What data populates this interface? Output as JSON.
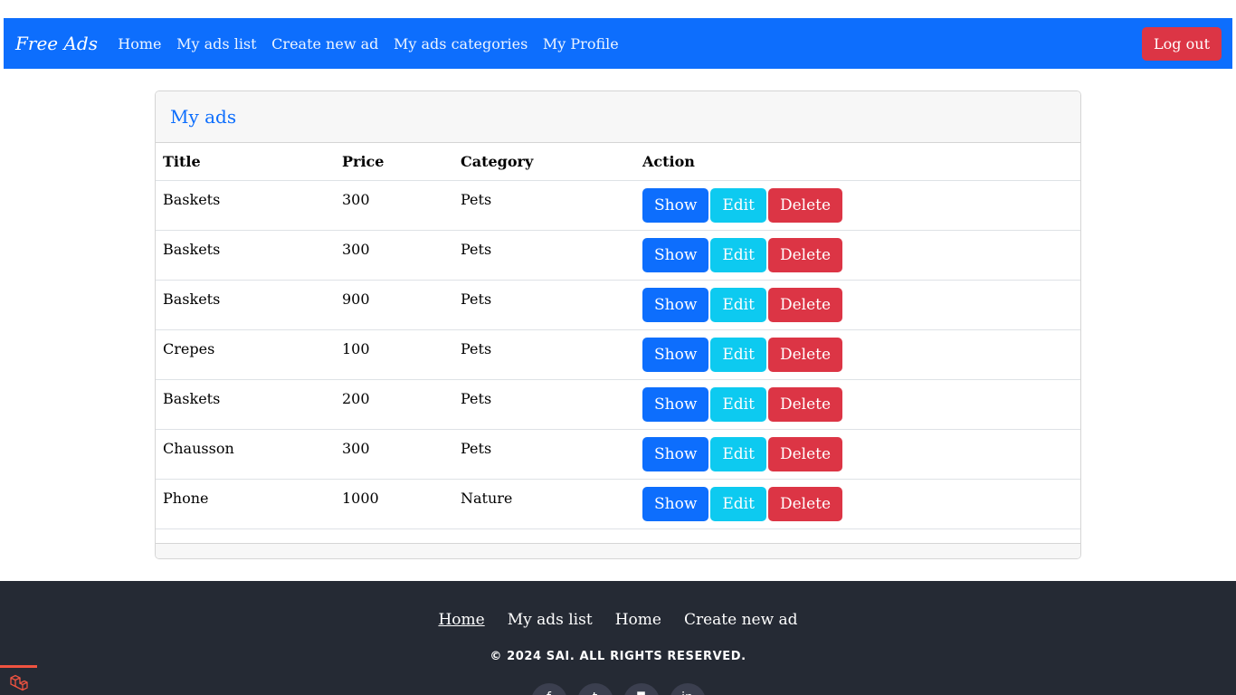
{
  "navbar": {
    "brand": "Free Ads",
    "links": [
      "Home",
      "My ads list",
      "Create new ad",
      "My ads categories",
      "My Profile"
    ],
    "logout_label": "Log out"
  },
  "card": {
    "title": "My ads",
    "columns": [
      "Title",
      "Price",
      "Category",
      "Action"
    ],
    "rows": [
      {
        "title": "Baskets",
        "price": "300",
        "category": "Pets"
      },
      {
        "title": "Baskets",
        "price": "300",
        "category": "Pets"
      },
      {
        "title": "Baskets",
        "price": "900",
        "category": "Pets"
      },
      {
        "title": "Crepes",
        "price": "100",
        "category": "Pets"
      },
      {
        "title": "Baskets",
        "price": "200",
        "category": "Pets"
      },
      {
        "title": "Chausson",
        "price": "300",
        "category": "Pets"
      },
      {
        "title": "Phone",
        "price": "1000",
        "category": "Nature"
      }
    ],
    "actions": {
      "show": "Show",
      "edit": "Edit",
      "delete": "Delete"
    }
  },
  "footer": {
    "links": [
      "Home",
      "My ads list",
      "Home",
      "Create new ad"
    ],
    "copyright": "© 2024 SAI. ALL RIGHTS RESERVED.",
    "socials": [
      {
        "icon": "facebook-icon",
        "glyph": "f"
      },
      {
        "icon": "twitter-icon",
        "glyph": "t"
      },
      {
        "icon": "instagram-icon",
        "glyph": "◘"
      },
      {
        "icon": "linkedin-icon",
        "glyph": "in"
      }
    ]
  },
  "colors": {
    "primary": "#0d6efd",
    "info": "#0dcaf0",
    "danger": "#dc3545",
    "footer_bg": "#252a34",
    "laravel_red": "#f05340"
  }
}
